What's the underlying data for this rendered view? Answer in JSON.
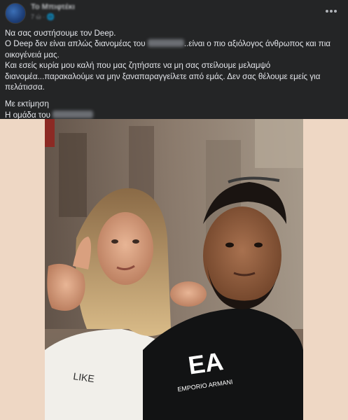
{
  "post": {
    "author": "Το Μπιφτέκι",
    "timestamp": "7 ώ · 🌐",
    "more_icon": "ellipsis-icon",
    "body": {
      "line1": "Να σας συστήσουμε τον Deep.",
      "line2a": "Ο Deep δεν είναι απλώς διανομέας του",
      "line2b": "..είναι ο πιο αξιόλογος άνθρωπος και πια",
      "line3": "οικογένειά μας.",
      "line4": "Και εσείς κυρία μου καλή που μας ζητήσατε να μη σας στείλουμε μελαμψό",
      "line5": "διανομέα...παρακαλούμε να μην ξαναπαραγγείλετε από εμάς. Δεν σας θέλουμε εμείς για",
      "line6": "πελάτισσα.",
      "line7": "Με εκτίμηση",
      "line8": "Η ομάδα του"
    },
    "shirt_text": "EA",
    "shirt_sub": "EMPORIO ARMANI",
    "tshirt_text": "LIKE"
  },
  "colors": {
    "background": "#242526",
    "text": "#e4e6eb",
    "photo_backdrop": "#eed7c4"
  }
}
